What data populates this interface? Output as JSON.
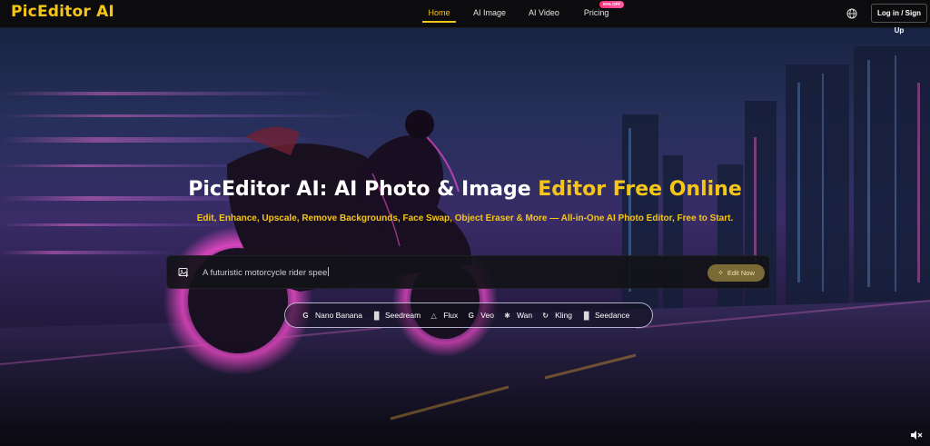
{
  "header": {
    "logo": "PicEditor AI",
    "nav": [
      {
        "label": "Home"
      },
      {
        "label": "AI Image"
      },
      {
        "label": "AI Video"
      },
      {
        "label": "Pricing",
        "badge": "50% OFF"
      }
    ],
    "globe_icon": "globe-icon",
    "login_label": "Log in / Sign Up"
  },
  "hero": {
    "title_white": "PicEditor AI: AI Photo & Image ",
    "title_yellow": "Editor Free Online",
    "subtitle": "Edit, Enhance, Upscale, Remove Backgrounds, Face Swap, Object Eraser & More — All-in-One AI Photo Editor, Free to Start.",
    "prompt": {
      "value": "A futuristic motorcycle rider spee",
      "image_icon": "image-upload-icon",
      "button_label": "Edit Now",
      "button_icon": "sparkle-icon"
    },
    "models": [
      {
        "label": "Nano Banana",
        "icon": "G"
      },
      {
        "label": "Seedream",
        "icon": "bars"
      },
      {
        "label": "Flux",
        "icon": "triangle"
      },
      {
        "label": "Veo",
        "icon": "G"
      },
      {
        "label": "Wan",
        "icon": "swirl"
      },
      {
        "label": "Kling",
        "icon": "spiral"
      },
      {
        "label": "Seedance",
        "icon": "bars"
      }
    ],
    "mute_icon": "speaker-muted-icon"
  },
  "colors": {
    "accent": "#f5c518",
    "badge": "#ff2d78",
    "nav_bg": "#0c0c0e",
    "button_bg": "#7a6a36"
  }
}
